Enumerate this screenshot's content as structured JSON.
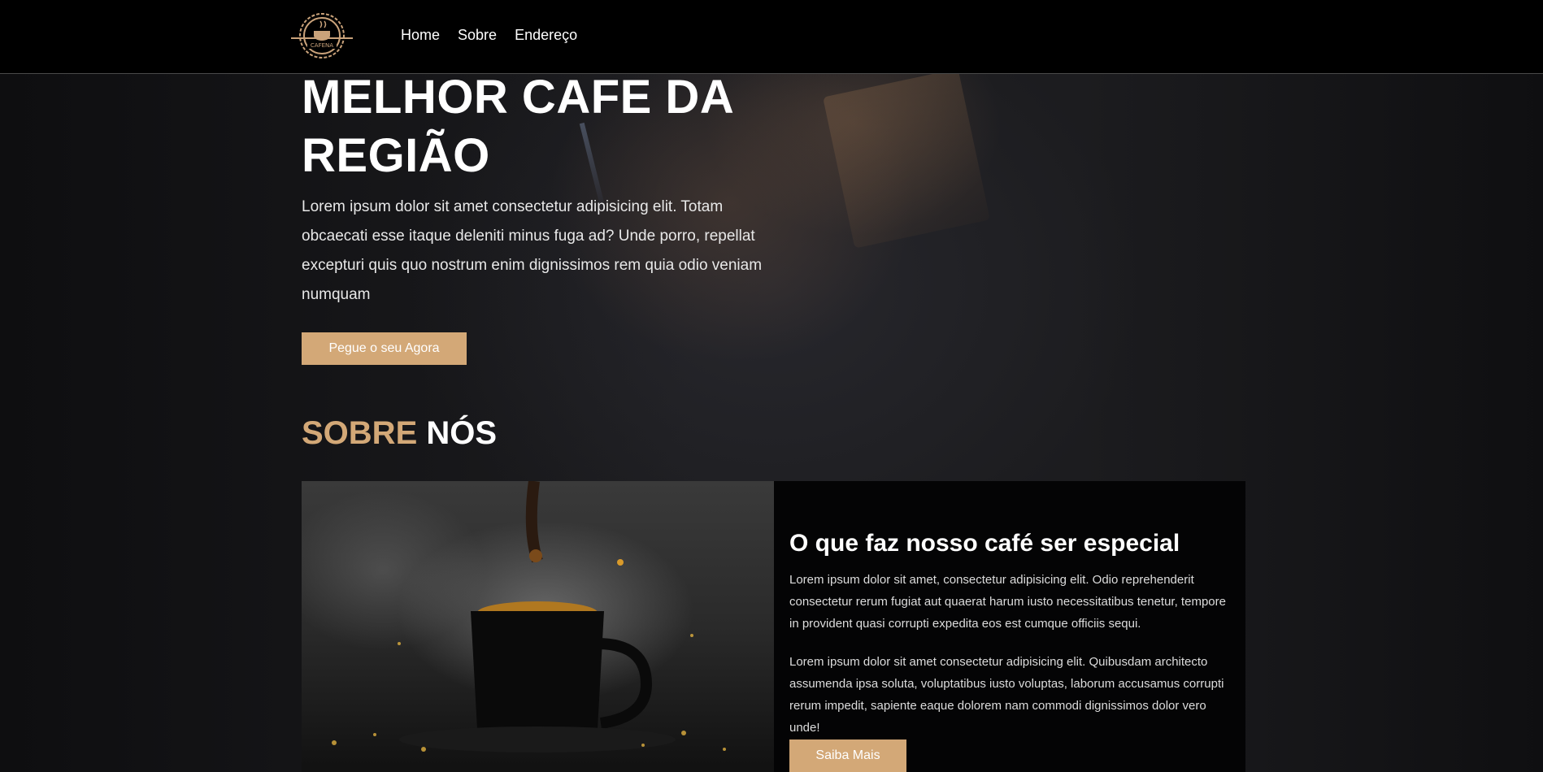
{
  "header": {
    "logo_text": "CAFENA",
    "nav": [
      "Home",
      "Sobre",
      "Endereço"
    ]
  },
  "hero": {
    "title_line1": "MELHOR CAFE DA",
    "title_line2": "REGIÃO",
    "text": "Lorem ipsum dolor sit amet consectetur adipisicing elit. Totam obcaecati esse itaque deleniti minus fuga ad? Unde porro, repellat excepturi quis quo nostrum enim dignissimos rem quia odio veniam numquam",
    "button": "Pegue o seu Agora"
  },
  "about": {
    "title_gold": "SOBRE",
    "title_white": "NÓS",
    "card_title": "O que faz nosso café ser especial",
    "p1": "Lorem ipsum dolor sit amet, consectetur adipisicing elit. Odio reprehenderit consectetur rerum fugiat aut quaerat harum iusto necessitatibus tenetur, tempore in provident quasi corrupti expedita eos est cumque officiis sequi.",
    "p2": "Lorem ipsum dolor sit amet consectetur adipisicing elit. Quibusdam architecto assumenda ipsa soluta, voluptatibus iusto voluptas, laborum accusamus corrupti rerum impedit, sapiente eaque dolorem nam commodi dignissimos dolor vero unde!",
    "button": "Saiba Mais"
  },
  "colors": {
    "accent": "#d3a877",
    "header_bg": "#000000",
    "card_bg": "#040405"
  }
}
